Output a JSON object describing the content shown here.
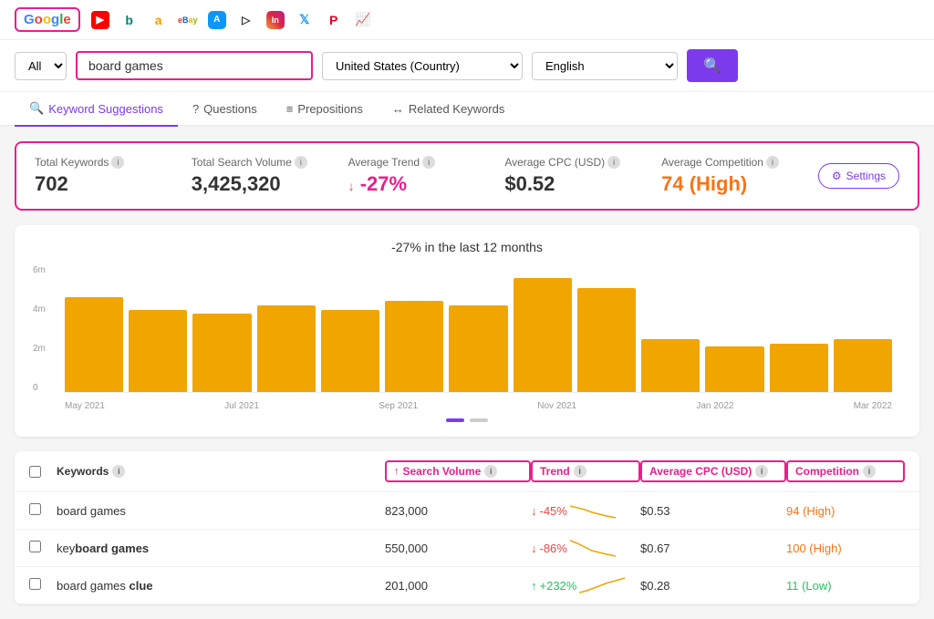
{
  "engines": [
    {
      "name": "Google",
      "id": "google"
    },
    {
      "name": "YouTube",
      "id": "youtube"
    },
    {
      "name": "Bing",
      "id": "bing"
    },
    {
      "name": "Amazon",
      "id": "amazon"
    },
    {
      "name": "eBay",
      "id": "ebay"
    },
    {
      "name": "App Store",
      "id": "appstore"
    },
    {
      "name": "Google Play",
      "id": "googleplay"
    },
    {
      "name": "Instagram",
      "id": "instagram"
    },
    {
      "name": "Twitter",
      "id": "twitter"
    },
    {
      "name": "Pinterest",
      "id": "pinterest"
    },
    {
      "name": "News",
      "id": "news"
    }
  ],
  "search": {
    "filter_label": "All",
    "keyword": "board games",
    "country": "United States (Country)",
    "language": "English",
    "search_placeholder": "board games"
  },
  "tabs": [
    {
      "label": "Keyword Suggestions",
      "icon": "🔍",
      "active": true
    },
    {
      "label": "Questions",
      "icon": "?"
    },
    {
      "label": "Prepositions",
      "icon": "≡"
    },
    {
      "label": "Related Keywords",
      "icon": "↔"
    }
  ],
  "stats": {
    "total_keywords_label": "Total Keywords",
    "total_keywords_value": "702",
    "total_search_volume_label": "Total Search Volume",
    "total_search_volume_value": "3,425,320",
    "avg_trend_label": "Average Trend",
    "avg_trend_value": "-27%",
    "avg_cpc_label": "Average CPC (USD)",
    "avg_cpc_value": "$0.52",
    "avg_competition_label": "Average Competition",
    "avg_competition_value": "74 (High)",
    "settings_label": "Settings"
  },
  "chart": {
    "title": "-27% in the last 12 months",
    "y_labels": [
      "6m",
      "4m",
      "2m",
      "0"
    ],
    "x_labels": [
      "May 2021",
      "Jul 2021",
      "Sep 2021",
      "Nov 2021",
      "Jan 2022",
      "Mar 2022"
    ],
    "bars": [
      75,
      65,
      60,
      68,
      72,
      70,
      68,
      90,
      82,
      40,
      35,
      38,
      42
    ],
    "bar_heights": [
      "75%",
      "65%",
      "60%",
      "68%",
      "72%",
      "70%",
      "68%",
      "90%",
      "82%",
      "40%",
      "35%",
      "38%",
      "42%"
    ]
  },
  "table": {
    "headers": {
      "select_all": "",
      "keywords": "Keywords",
      "search_volume": "↑ Search Volume",
      "trend": "Trend",
      "avg_cpc": "Average CPC (USD)",
      "competition": "Competition"
    },
    "rows": [
      {
        "keyword": "board games",
        "keyword_bold": "",
        "search_volume": "823,000",
        "trend": "-45%",
        "trend_dir": "neg",
        "avg_cpc": "$0.53",
        "competition": "94 (High)",
        "comp_level": "high",
        "trend_bars": [
          60,
          55,
          50,
          45,
          40,
          38,
          35
        ]
      },
      {
        "keyword": "key",
        "keyword_bold": "board games",
        "search_volume": "550,000",
        "trend": "-86%",
        "trend_dir": "neg",
        "avg_cpc": "$0.67",
        "competition": "100 (High)",
        "comp_level": "high",
        "trend_bars": [
          50,
          45,
          40,
          35,
          25,
          20,
          15
        ]
      },
      {
        "keyword": "board games clue",
        "keyword_bold": "",
        "search_volume": "201,000",
        "trend": "+232%",
        "trend_dir": "pos",
        "avg_cpc": "$0.28",
        "competition": "11 (Low)",
        "comp_level": "low",
        "trend_bars": [
          15,
          20,
          25,
          35,
          45,
          55,
          70
        ]
      }
    ]
  }
}
